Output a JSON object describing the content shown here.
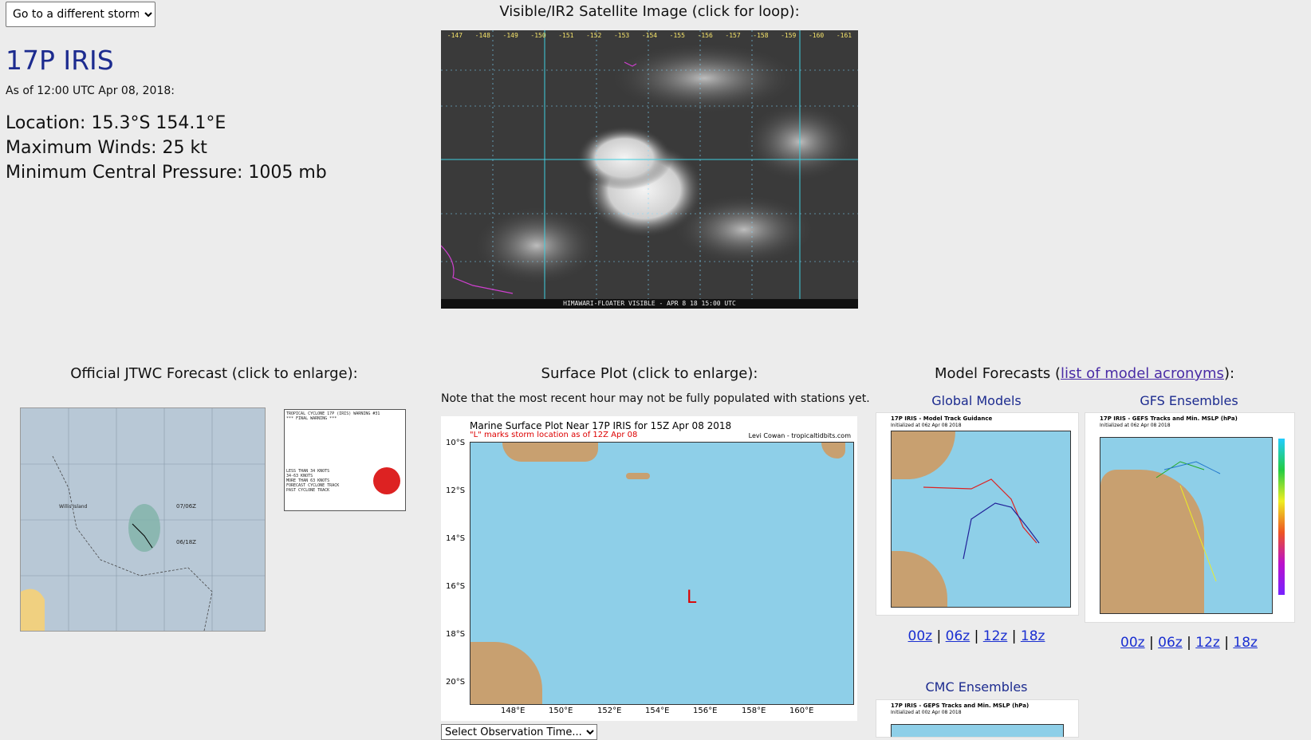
{
  "storm_select": {
    "value": "Go to a different storm..."
  },
  "storm": {
    "title": "17P IRIS",
    "as_of": "As of 12:00 UTC Apr 08, 2018:",
    "location": "Location: 15.3°S 154.1°E",
    "max_winds": "Maximum Winds: 25 kt",
    "min_pressure": "Minimum Central Pressure: 1005 mb"
  },
  "satellite": {
    "heading": "Visible/IR2 Satellite Image (click for loop):",
    "banner": "HIMAWARI-FLOATER VISIBLE - APR 8 18 15:00 UTC",
    "lon_ticks": [
      "-147",
      "-148",
      "-149",
      "-150",
      "-151",
      "-152",
      "-153",
      "-154",
      "-155",
      "-156",
      "-157",
      "-158",
      "-159",
      "-160",
      "-161"
    ]
  },
  "jtwc": {
    "heading": "Official JTWC Forecast (click to enlarge):",
    "legend_lines": [
      "TROPICAL CYCLONE 17P (IRIS) WARNING #31",
      "*** FINAL WARNING ***",
      "LESS THAN 34 KNOTS",
      "34-63 KNOTS",
      "MORE THAN 63 KNOTS",
      "FORECAST CYCLONE TRACK",
      "PAST CYCLONE TRACK"
    ],
    "map_labels": [
      "Willis Island",
      "07/06Z",
      "06/18Z"
    ]
  },
  "surface": {
    "heading": "Surface Plot (click to enlarge):",
    "note": "Note that the most recent hour may not be fully populated with stations yet.",
    "title": "Marine Surface Plot Near 17P IRIS for 15Z Apr 08 2018",
    "subtitle": "\"L\" marks storm location as of 12Z Apr 08",
    "credit": "Levi Cowan - tropicaltidbits.com",
    "marker": "L",
    "lat_labels": [
      "10°S",
      "12°S",
      "14°S",
      "16°S",
      "18°S",
      "20°S"
    ],
    "lon_labels": [
      "148°E",
      "150°E",
      "152°E",
      "154°E",
      "156°E",
      "158°E",
      "160°E"
    ],
    "obs_select": "Select Observation Time..."
  },
  "models": {
    "heading_prefix": "Model Forecasts (",
    "heading_link": "list of model acronyms",
    "heading_suffix": "):",
    "global": {
      "label": "Global Models",
      "img_title": "17P IRIS - Model Track Guidance",
      "img_subtitle": "Initialized at 06z Apr 08 2018",
      "runs": [
        "00z",
        "06z",
        "12z",
        "18z"
      ]
    },
    "gfs": {
      "label": "GFS Ensembles",
      "img_title": "17P IRIS - GEFS Tracks and Min. MSLP (hPa)",
      "img_subtitle": "Initialized at 06z Apr 08 2018",
      "runs": [
        "00z",
        "06z",
        "12z",
        "18z"
      ]
    },
    "cmc": {
      "label": "CMC Ensembles",
      "img_title": "17P IRIS - GEPS Tracks and Min. MSLP (hPa)",
      "img_subtitle": "Initialized at 00z Apr 08 2018"
    },
    "separator": "|"
  }
}
